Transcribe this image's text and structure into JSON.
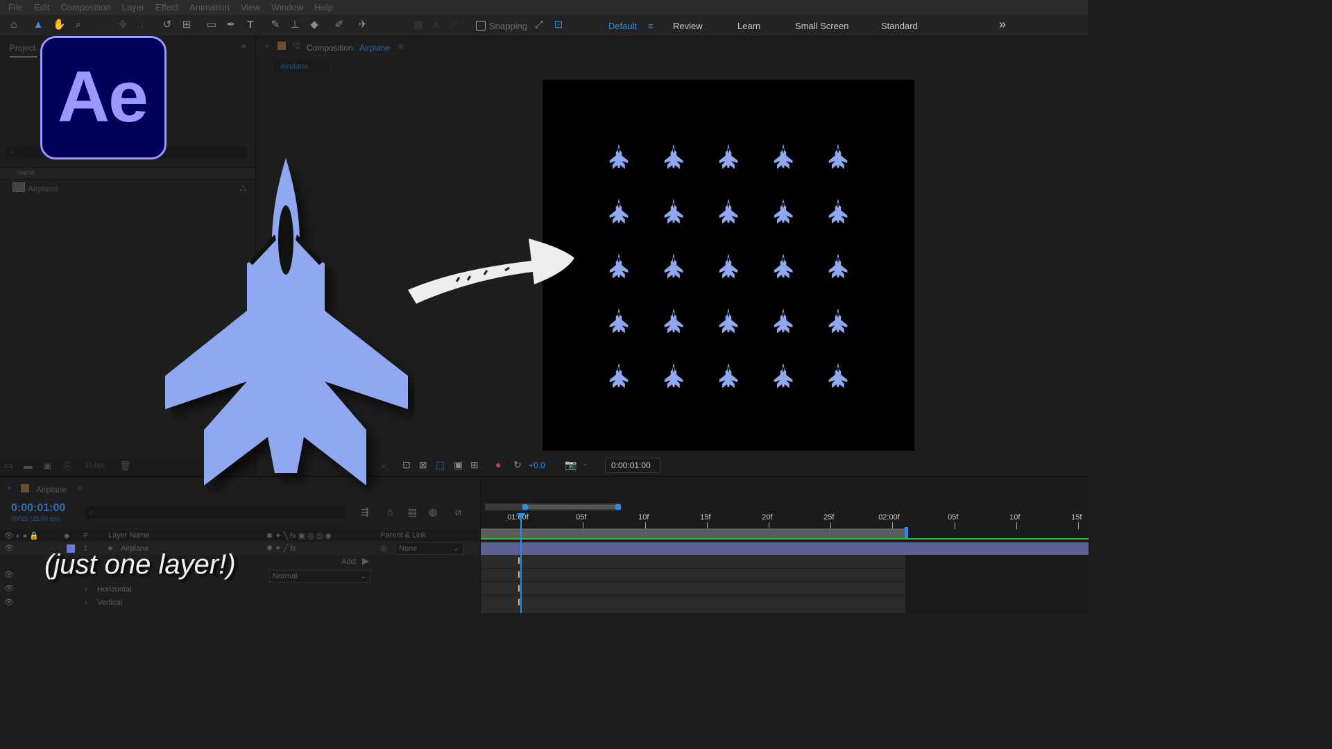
{
  "menu": [
    "File",
    "Edit",
    "Composition",
    "Layer",
    "Effect",
    "Animation",
    "View",
    "Window",
    "Help"
  ],
  "toolbar": {
    "snapping_label": "Snapping",
    "workspaces": [
      "Default",
      "Review",
      "Learn",
      "Small Screen",
      "Standard"
    ],
    "active_workspace": "Default",
    "more_label": "»"
  },
  "project_panel": {
    "tab_label": "Project",
    "column_name": "Name",
    "item_name": "Airplane",
    "fps_label": "16 bpc"
  },
  "composition_panel": {
    "title_prefix": "Composition",
    "comp_name": "Airplane",
    "tab_label": "Airplane",
    "exposure_value": "+0.0",
    "timecode": "0:00:01:00"
  },
  "timeline": {
    "comp_tab": "Airplane",
    "current_time": "0:00:01:00",
    "frames_info": "00025 (25.00 fps)",
    "columns": {
      "layer_name": "Layer Name",
      "parent": "Parent & Link"
    },
    "layer": {
      "index": "1",
      "name": "Airplane",
      "parent": "None"
    },
    "add_label": "Add:",
    "mode": "Normal",
    "sub_props": [
      "Horizontal",
      "Vertical"
    ],
    "ticks": [
      "01:00f",
      "05f",
      "10f",
      "15f",
      "20f",
      "25f",
      "02:00f",
      "05f",
      "10f",
      "15f"
    ]
  },
  "overlay": {
    "logo_text": "Ae",
    "caption": "(just one layer!)",
    "accent": "#8fa8ef",
    "logo_bg": "#00005b",
    "logo_border": "#9999ff"
  }
}
